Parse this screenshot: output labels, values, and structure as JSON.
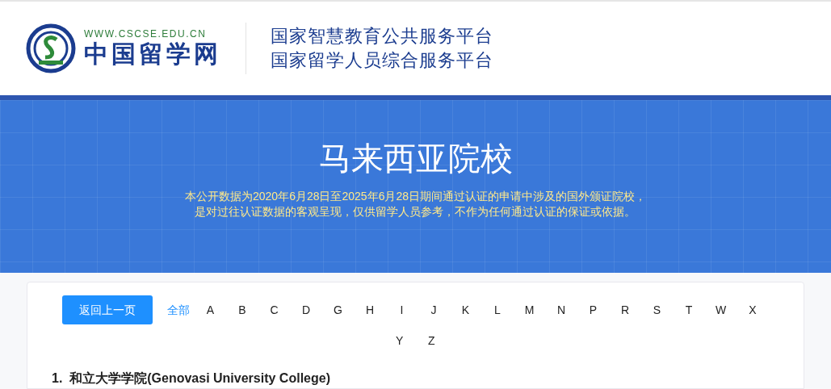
{
  "header": {
    "logo_url": "WWW.CSCSE.EDU.CN",
    "logo_name": "中国留学网",
    "platform_names": [
      "国家智慧教育公共服务平台",
      "国家留学人员综合服务平台"
    ]
  },
  "banner": {
    "title": "马来西亚院校",
    "notes": [
      "本公开数据为2020年6月28日至2025年6月28日期间通过认证的申请中涉及的国外颁证院校，",
      "是对过往认证数据的客观呈现，仅供留学人员参考，不作为任何通过认证的保证或依据。"
    ]
  },
  "back_button": "返回上一页",
  "letters": [
    {
      "label": "全部",
      "selected": true
    },
    {
      "label": "A",
      "selected": false
    },
    {
      "label": "B",
      "selected": false
    },
    {
      "label": "C",
      "selected": false
    },
    {
      "label": "D",
      "selected": false
    },
    {
      "label": "G",
      "selected": false
    },
    {
      "label": "H",
      "selected": false
    },
    {
      "label": "I",
      "selected": false
    },
    {
      "label": "J",
      "selected": false
    },
    {
      "label": "K",
      "selected": false
    },
    {
      "label": "L",
      "selected": false
    },
    {
      "label": "M",
      "selected": false
    },
    {
      "label": "N",
      "selected": false
    },
    {
      "label": "P",
      "selected": false
    },
    {
      "label": "R",
      "selected": false
    },
    {
      "label": "S",
      "selected": false
    },
    {
      "label": "T",
      "selected": false
    },
    {
      "label": "W",
      "selected": false
    },
    {
      "label": "X",
      "selected": false
    },
    {
      "label": "Y",
      "selected": false
    },
    {
      "label": "Z",
      "selected": false
    }
  ],
  "schools": [
    {
      "number": "1.",
      "name": "和立大学学院(Genovasi University College)"
    }
  ]
}
